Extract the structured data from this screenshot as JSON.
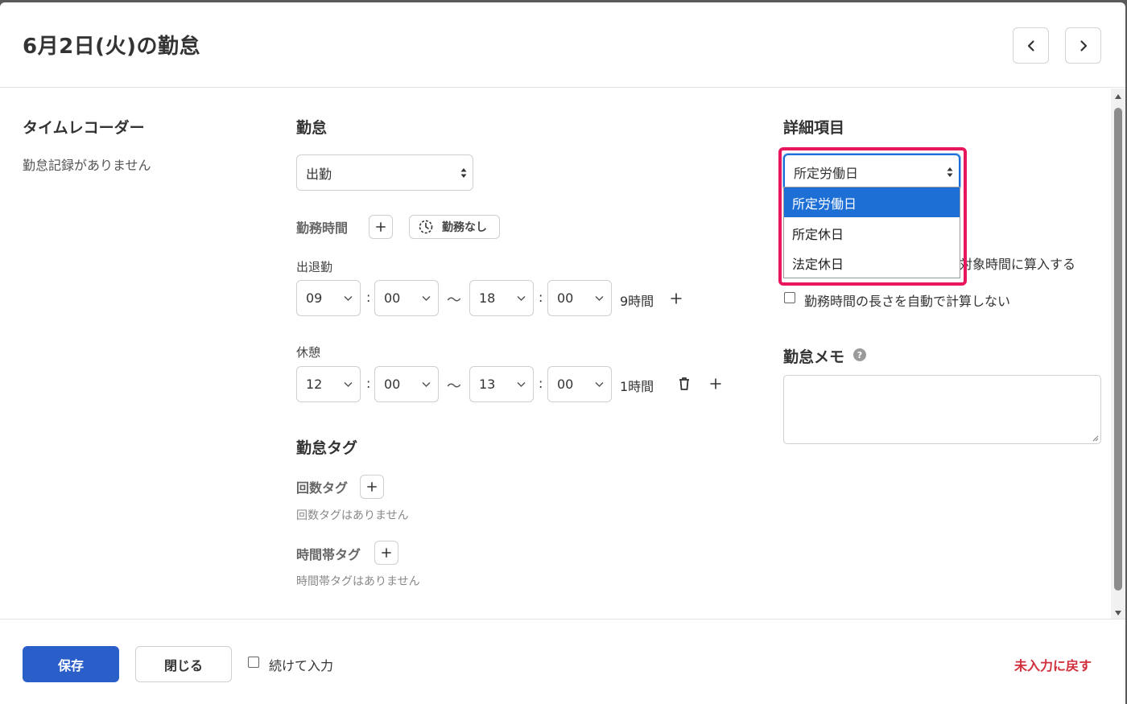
{
  "header": {
    "title": "6月2日(火)の勤怠",
    "prev_icon": "chevron-left-icon",
    "next_icon": "chevron-right-icon"
  },
  "timerecorder": {
    "heading": "タイムレコーダー",
    "empty": "勤怠記録がありません"
  },
  "attendance": {
    "heading": "勤怠",
    "type_value": "出勤",
    "work_time_label": "勤務時間",
    "no_work_label": "勤務なし",
    "clock_label": "出退勤",
    "clock": {
      "start_h": "09",
      "start_m": "00",
      "end_h": "18",
      "end_m": "00",
      "duration": "9時間"
    },
    "break_label": "休憩",
    "break": {
      "start_h": "12",
      "start_m": "00",
      "end_h": "13",
      "end_m": "00",
      "duration": "1時間"
    },
    "colon": ":",
    "tilde": "〜"
  },
  "tags": {
    "heading": "勤怠タグ",
    "count_label": "回数タグ",
    "count_empty": "回数タグはありません",
    "timeband_label": "時間帯タグ",
    "timeband_empty": "時間帯タグはありません"
  },
  "details": {
    "heading": "詳細項目",
    "day_type_value": "所定労働日",
    "options": [
      "所定労働日",
      "所定休日",
      "法定休日"
    ],
    "partial_text": "対象時間に算入する",
    "no_auto_calc_label": "勤務時間の長さを自動で計算しない"
  },
  "memo": {
    "heading": "勤怠メモ",
    "help": "?"
  },
  "footer": {
    "save_label": "保存",
    "close_label": "閉じる",
    "continue_label": "続けて入力",
    "reset_label": "未入力に戻す"
  },
  "colors": {
    "primary": "#2a5fc9",
    "danger": "#d22f3c",
    "highlight": "#e8175d",
    "selected_option": "#1d6fd6"
  }
}
